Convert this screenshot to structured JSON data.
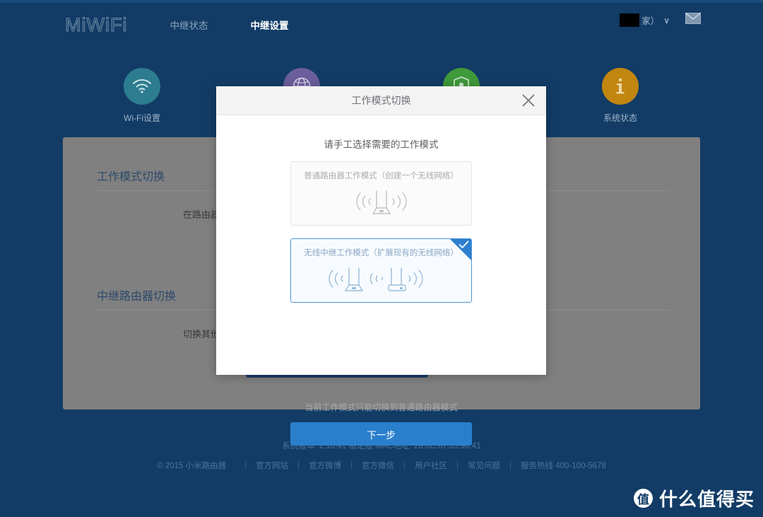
{
  "header": {
    "logo": "MiWiFi",
    "nav": [
      {
        "label": "中继状态",
        "active": false
      },
      {
        "label": "中继设置",
        "active": true
      }
    ],
    "user_name": "家）",
    "chevron": "∨",
    "mail_icon": "mail-icon"
  },
  "quick_icons": [
    {
      "label": "Wi-Fi设置",
      "icon": "wifi-icon",
      "color": "#2c7d8f"
    },
    {
      "label": "",
      "icon": "globe-icon",
      "color": "#6b5e9c"
    },
    {
      "label": "",
      "icon": "shield-user-icon",
      "color": "#3f9a3a"
    },
    {
      "label": "系统状态",
      "icon": "info-icon",
      "color": "#c2860f"
    }
  ],
  "panel": {
    "sections": [
      {
        "title": "工作模式切换",
        "text": "在路由器工",
        "button_label": ""
      },
      {
        "title": "中继路由器切换",
        "text": "切换其他路",
        "button_label": ""
      }
    ]
  },
  "modal": {
    "title": "工作模式切换",
    "close_icon": "close-icon",
    "subtitle": "请手工选择需要的工作模式",
    "options": [
      {
        "label": "普通路由器工作模式（创建一个无线网络）",
        "icon": "router-single-icon",
        "selected": false
      },
      {
        "label": "无线中继工作模式（扩展现有的无线网络）",
        "icon": "router-repeater-icon",
        "selected": true
      }
    ],
    "hint": "当前工作模式只能切换到普通路由器模式",
    "next_label": "下一步"
  },
  "footer": {
    "firmware": "系统版本: 2.10.41 稳定版  MAC地址: 28:6C:07:63:96:41",
    "copyright": "© 2015 小米路由器",
    "links": [
      "官方网站",
      "官方微博",
      "官方微信",
      "用户社区",
      "常见问题"
    ],
    "hotline": "服务热线 400-100-5678",
    "separator": "|"
  },
  "watermark": {
    "badge": "值",
    "text": "什么值得买"
  },
  "colors": {
    "page_bg": "#123c66",
    "panel_bg": "#808080",
    "accent_blue": "#2a7fcc",
    "dark_button": "#1d3f6b",
    "selected_border": "#4f93d4"
  }
}
